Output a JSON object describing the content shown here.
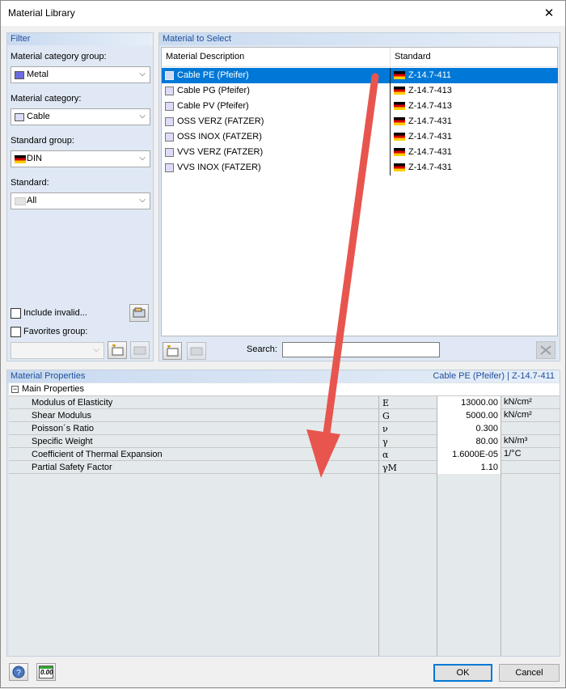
{
  "window": {
    "title": "Material Library"
  },
  "filter": {
    "title": "Filter",
    "category_group_label": "Material category group:",
    "category_group_value": "Metal",
    "category_label": "Material category:",
    "category_value": "Cable",
    "standard_group_label": "Standard group:",
    "standard_group_value": "DIN",
    "standard_label": "Standard:",
    "standard_value": "All",
    "include_invalid": "Include invalid...",
    "favorites_group": "Favorites group:"
  },
  "select": {
    "title": "Material to Select",
    "col_description": "Material Description",
    "col_standard": "Standard",
    "rows": [
      {
        "desc": "Cable PE (Pfeifer)",
        "std": "Z-14.7-411"
      },
      {
        "desc": "Cable PG (Pfeifer)",
        "std": "Z-14.7-413"
      },
      {
        "desc": "Cable PV (Pfeifer)",
        "std": "Z-14.7-413"
      },
      {
        "desc": "OSS VERZ (FATZER)",
        "std": "Z-14.7-431"
      },
      {
        "desc": "OSS INOX (FATZER)",
        "std": "Z-14.7-431"
      },
      {
        "desc": "VVS VERZ (FATZER)",
        "std": "Z-14.7-431"
      },
      {
        "desc": "VVS INOX (FATZER)",
        "std": "Z-14.7-431"
      }
    ],
    "search_label": "Search:"
  },
  "properties": {
    "title": "Material Properties",
    "selected_material": "Cable PE (Pfeifer)",
    "separator": "|",
    "selected_standard": "Z-14.7-411",
    "group_label": "Main Properties",
    "rows": [
      {
        "name": "Modulus of Elasticity",
        "symbol": "E",
        "value": "13000.00",
        "unit": "kN/cm²"
      },
      {
        "name": "Shear Modulus",
        "symbol": "G",
        "value": "5000.00",
        "unit": "kN/cm²"
      },
      {
        "name": "Poisson´s Ratio",
        "symbol": "ν",
        "value": "0.300",
        "unit": ""
      },
      {
        "name": "Specific Weight",
        "symbol": "γ",
        "value": "80.00",
        "unit": "kN/m³"
      },
      {
        "name": "Coefficient of Thermal Expansion",
        "symbol": "α",
        "value": "1.6000E-05",
        "unit": "1/°C"
      },
      {
        "name": "Partial Safety Factor",
        "symbol": "γM",
        "value": "1.10",
        "unit": ""
      }
    ]
  },
  "buttons": {
    "ok": "OK",
    "cancel": "Cancel",
    "units_icon_text": "0.00"
  },
  "colors": {
    "accent": "#0078d7",
    "arrow": "#e8554e",
    "panel_header": "#1f4e9b"
  }
}
